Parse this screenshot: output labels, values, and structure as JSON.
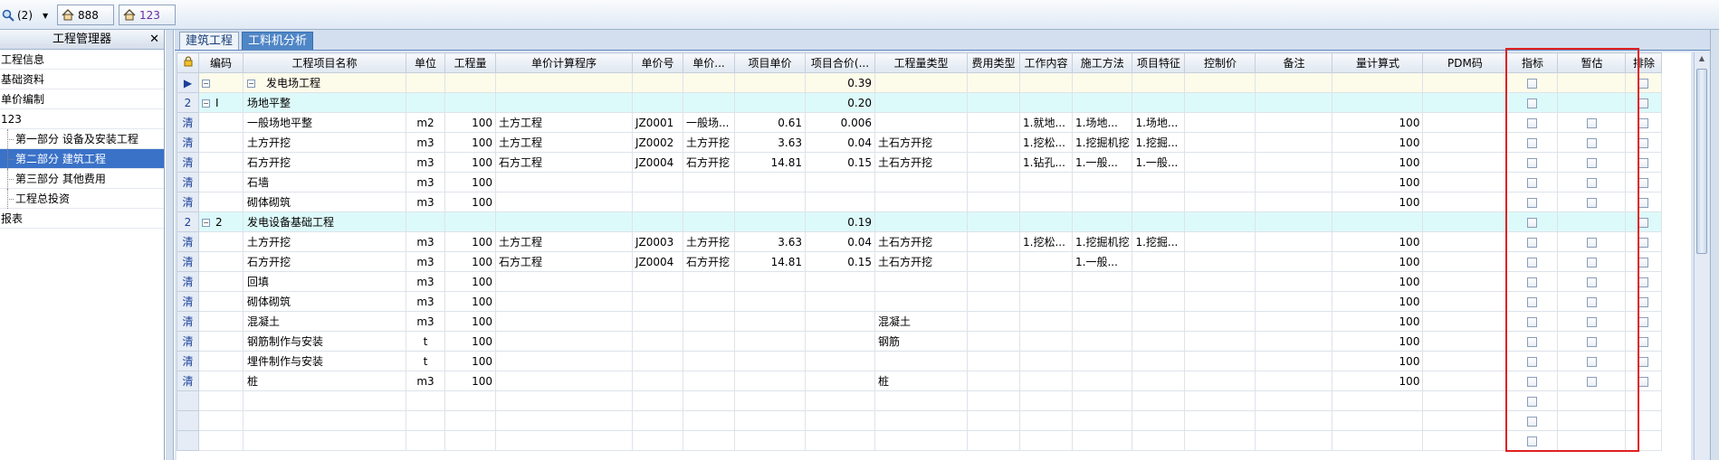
{
  "toolbar": {
    "search_label": "(2)",
    "project_tab_1": "888",
    "project_tab_2": "123"
  },
  "sidebar": {
    "title": "工程管理器",
    "close_glyph": "✕",
    "items": [
      {
        "label": "工程信息"
      },
      {
        "label": "基础资料"
      },
      {
        "label": "单价编制"
      },
      {
        "label": "123"
      },
      {
        "label": "第一部分 设备及安装工程"
      },
      {
        "label": "第二部分 建筑工程"
      },
      {
        "label": "第三部分 其他费用"
      },
      {
        "label": "工程总投资"
      },
      {
        "label": "报表"
      }
    ]
  },
  "tabs": [
    {
      "label": "建筑工程"
    },
    {
      "label": "工料机分析"
    }
  ],
  "columns": [
    "编码",
    "工程项目名称",
    "单位",
    "工程量",
    "单价计算程序",
    "单价号",
    "单价...",
    "项目单价",
    "项目合价(...",
    "工程量类型",
    "费用类型",
    "工作内容",
    "施工方法",
    "项目特征",
    "控制价",
    "备注",
    "量计算式",
    "PDM码",
    "指标",
    "暂估",
    "排除"
  ],
  "rows": [
    {
      "rh": "▶",
      "level": 0,
      "code": "",
      "name": "发电场工程",
      "unit": "",
      "qty": "",
      "calc": "",
      "pno": "",
      "pname": "",
      "price": "",
      "total": "0.39",
      "qtype": "",
      "ftype": "",
      "work": "",
      "method": "",
      "feature": "",
      "ctrl": "",
      "remark": "",
      "formula": "",
      "pdm": ""
    },
    {
      "rh": "2",
      "level": 1,
      "code": "I",
      "name": "场地平整",
      "unit": "",
      "qty": "",
      "calc": "",
      "pno": "",
      "pname": "",
      "price": "",
      "total": "0.20",
      "qtype": "",
      "ftype": "",
      "work": "",
      "method": "",
      "feature": "",
      "ctrl": "",
      "remark": "",
      "formula": "",
      "pdm": ""
    },
    {
      "rh": "清",
      "level": 2,
      "code": "",
      "name": "一般场地平整",
      "unit": "m2",
      "qty": "100",
      "calc": "土方工程",
      "pno": "JZ0001",
      "pname": "一般场...",
      "price": "0.61",
      "total": "0.006",
      "qtype": "",
      "ftype": "",
      "work": "1.就地...",
      "method": "1.场地...",
      "feature": "1.场地...",
      "ctrl": "",
      "remark": "",
      "formula": "100",
      "pdm": ""
    },
    {
      "rh": "清",
      "level": 2,
      "code": "",
      "name": "土方开挖",
      "unit": "m3",
      "qty": "100",
      "calc": "土方工程",
      "pno": "JZ0002",
      "pname": "土方开挖",
      "price": "3.63",
      "total": "0.04",
      "qtype": "土石方开挖",
      "ftype": "",
      "work": "1.挖松...",
      "method": "1.挖掘机挖",
      "feature": "1.挖掘...",
      "ctrl": "",
      "remark": "",
      "formula": "100",
      "pdm": ""
    },
    {
      "rh": "清",
      "level": 2,
      "code": "",
      "name": "石方开挖",
      "unit": "m3",
      "qty": "100",
      "calc": "石方工程",
      "pno": "JZ0004",
      "pname": "石方开挖",
      "price": "14.81",
      "total": "0.15",
      "qtype": "土石方开挖",
      "ftype": "",
      "work": "1.钻孔...",
      "method": "1.一般...",
      "feature": "1.一般...",
      "ctrl": "",
      "remark": "",
      "formula": "100",
      "pdm": ""
    },
    {
      "rh": "清",
      "level": 2,
      "code": "",
      "name": "石墙",
      "unit": "m3",
      "qty": "100",
      "calc": "",
      "pno": "",
      "pname": "",
      "price": "",
      "total": "",
      "qtype": "",
      "ftype": "",
      "work": "",
      "method": "",
      "feature": "",
      "ctrl": "",
      "remark": "",
      "formula": "100",
      "pdm": ""
    },
    {
      "rh": "清",
      "level": 2,
      "code": "",
      "name": "砌体砌筑",
      "unit": "m3",
      "qty": "100",
      "calc": "",
      "pno": "",
      "pname": "",
      "price": "",
      "total": "",
      "qtype": "",
      "ftype": "",
      "work": "",
      "method": "",
      "feature": "",
      "ctrl": "",
      "remark": "",
      "formula": "100",
      "pdm": ""
    },
    {
      "rh": "2",
      "level": 1,
      "code": "2",
      "name": "发电设备基础工程",
      "unit": "",
      "qty": "",
      "calc": "",
      "pno": "",
      "pname": "",
      "price": "",
      "total": "0.19",
      "qtype": "",
      "ftype": "",
      "work": "",
      "method": "",
      "feature": "",
      "ctrl": "",
      "remark": "",
      "formula": "",
      "pdm": ""
    },
    {
      "rh": "清",
      "level": 2,
      "code": "",
      "name": "土方开挖",
      "unit": "m3",
      "qty": "100",
      "calc": "土方工程",
      "pno": "JZ0003",
      "pname": "土方开挖",
      "price": "3.63",
      "total": "0.04",
      "qtype": "土石方开挖",
      "ftype": "",
      "work": "1.挖松...",
      "method": "1.挖掘机挖",
      "feature": "1.挖掘...",
      "ctrl": "",
      "remark": "",
      "formula": "100",
      "pdm": ""
    },
    {
      "rh": "清",
      "level": 2,
      "code": "",
      "name": "石方开挖",
      "unit": "m3",
      "qty": "100",
      "calc": "石方工程",
      "pno": "JZ0004",
      "pname": "石方开挖",
      "price": "14.81",
      "total": "0.15",
      "qtype": "土石方开挖",
      "ftype": "",
      "work": "",
      "method": "1.一般...",
      "feature": "",
      "ctrl": "",
      "remark": "",
      "formula": "100",
      "pdm": ""
    },
    {
      "rh": "清",
      "level": 2,
      "code": "",
      "name": "回填",
      "unit": "m3",
      "qty": "100",
      "calc": "",
      "pno": "",
      "pname": "",
      "price": "",
      "total": "",
      "qtype": "",
      "ftype": "",
      "work": "",
      "method": "",
      "feature": "",
      "ctrl": "",
      "remark": "",
      "formula": "100",
      "pdm": ""
    },
    {
      "rh": "清",
      "level": 2,
      "code": "",
      "name": "砌体砌筑",
      "unit": "m3",
      "qty": "100",
      "calc": "",
      "pno": "",
      "pname": "",
      "price": "",
      "total": "",
      "qtype": "",
      "ftype": "",
      "work": "",
      "method": "",
      "feature": "",
      "ctrl": "",
      "remark": "",
      "formula": "100",
      "pdm": ""
    },
    {
      "rh": "清",
      "level": 2,
      "code": "",
      "name": "混凝土",
      "unit": "m3",
      "qty": "100",
      "calc": "",
      "pno": "",
      "pname": "",
      "price": "",
      "total": "",
      "qtype": "混凝土",
      "ftype": "",
      "work": "",
      "method": "",
      "feature": "",
      "ctrl": "",
      "remark": "",
      "formula": "100",
      "pdm": ""
    },
    {
      "rh": "清",
      "level": 2,
      "code": "",
      "name": "钢筋制作与安装",
      "unit": "t",
      "qty": "100",
      "calc": "",
      "pno": "",
      "pname": "",
      "price": "",
      "total": "",
      "qtype": "钢筋",
      "ftype": "",
      "work": "",
      "method": "",
      "feature": "",
      "ctrl": "",
      "remark": "",
      "formula": "100",
      "pdm": ""
    },
    {
      "rh": "清",
      "level": 2,
      "code": "",
      "name": "埋件制作与安装",
      "unit": "t",
      "qty": "100",
      "calc": "",
      "pno": "",
      "pname": "",
      "price": "",
      "total": "",
      "qtype": "",
      "ftype": "",
      "work": "",
      "method": "",
      "feature": "",
      "ctrl": "",
      "remark": "",
      "formula": "100",
      "pdm": ""
    },
    {
      "rh": "清",
      "level": 2,
      "code": "",
      "name": "桩",
      "unit": "m3",
      "qty": "100",
      "calc": "",
      "pno": "",
      "pname": "",
      "price": "",
      "total": "",
      "qtype": "桩",
      "ftype": "",
      "work": "",
      "method": "",
      "feature": "",
      "ctrl": "",
      "remark": "",
      "formula": "100",
      "pdm": ""
    },
    {
      "rh": "",
      "level": 3,
      "code": "",
      "name": "",
      "unit": "",
      "qty": "",
      "calc": "",
      "pno": "",
      "pname": "",
      "price": "",
      "total": "",
      "qtype": "",
      "ftype": "",
      "work": "",
      "method": "",
      "feature": "",
      "ctrl": "",
      "remark": "",
      "formula": "",
      "pdm": ""
    },
    {
      "rh": "",
      "level": 3,
      "code": "",
      "name": "",
      "unit": "",
      "qty": "",
      "calc": "",
      "pno": "",
      "pname": "",
      "price": "",
      "total": "",
      "qtype": "",
      "ftype": "",
      "work": "",
      "method": "",
      "feature": "",
      "ctrl": "",
      "remark": "",
      "formula": "",
      "pdm": ""
    },
    {
      "rh": "",
      "level": 3,
      "code": "",
      "name": "",
      "unit": "",
      "qty": "",
      "calc": "",
      "pno": "",
      "pname": "",
      "price": "",
      "total": "",
      "qtype": "",
      "ftype": "",
      "work": "",
      "method": "",
      "feature": "",
      "ctrl": "",
      "remark": "",
      "formula": "",
      "pdm": ""
    }
  ]
}
